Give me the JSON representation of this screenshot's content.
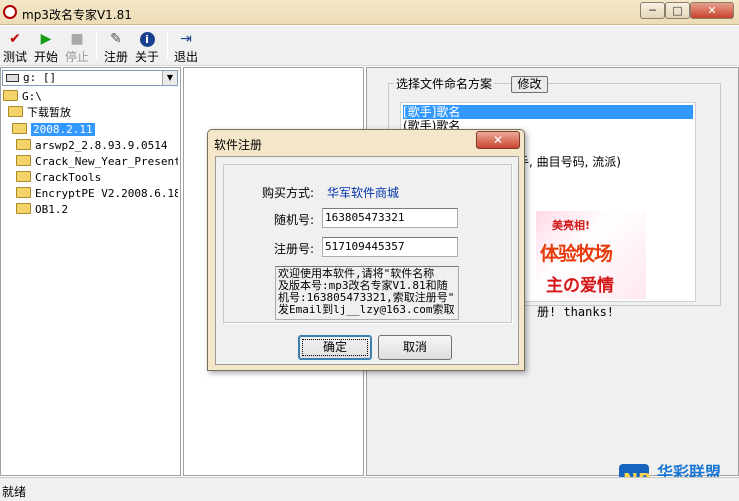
{
  "window": {
    "title": "mp3改名专家V1.81",
    "min_glyph": "─",
    "max_glyph": "□",
    "close_glyph": "✕"
  },
  "toolbar": {
    "items": [
      {
        "label": "测试",
        "icon": "check-icon"
      },
      {
        "label": "开始",
        "icon": "play-icon"
      },
      {
        "label": "停止",
        "icon": "stop-icon",
        "disabled": true
      },
      {
        "label": "注册",
        "icon": "register-icon"
      },
      {
        "label": "关于",
        "icon": "info-icon"
      },
      {
        "label": "退出",
        "icon": "exit-icon"
      }
    ]
  },
  "left_pane": {
    "drive": "g: []",
    "tree": [
      {
        "label": "G:\\"
      },
      {
        "label": "下载暂放"
      },
      {
        "label": "2008.2.11",
        "selected": true
      },
      {
        "label": "arswp2_2.8.93.9.0514"
      },
      {
        "label": "Crack_New_Year_Presents_"
      },
      {
        "label": "CrackTools"
      },
      {
        "label": "EncryptPE V2.2008.6.18 S"
      },
      {
        "label": "OB1.2"
      }
    ]
  },
  "right_pane": {
    "group_title": "选择文件命名方案",
    "modify_label": "修改",
    "schemes": [
      {
        "label": "[歌手]歌名",
        "selected": true
      },
      {
        "label": "(歌手)歌名"
      },
      {
        "label": "手, 曲目号码, 流派)"
      }
    ],
    "banner": {
      "top": "美亮相!",
      "mid": "体验牧场",
      "bot": "主の爱情"
    },
    "thanks": "册! thanks!"
  },
  "status_bar": {
    "text": "就绪"
  },
  "dialog": {
    "title": "软件注册",
    "close_glyph": "✕",
    "buy_label": "购买方式:",
    "buy_link": "华军软件商城",
    "random_label": "随机号:",
    "random_value": "163805473321",
    "reg_label": "注册号:",
    "reg_value": "517109445357",
    "welcome": "欢迎使用本软件,请将\"软件名称\n及版本号:mp3改名专家V1.81和随\n机号:163805473321,索取注册号\"\n发Email到lj__lzy@163.com索取",
    "ok_label": "确定",
    "cancel_label": "取消"
  },
  "watermark": {
    "text": "华彩联盟"
  }
}
